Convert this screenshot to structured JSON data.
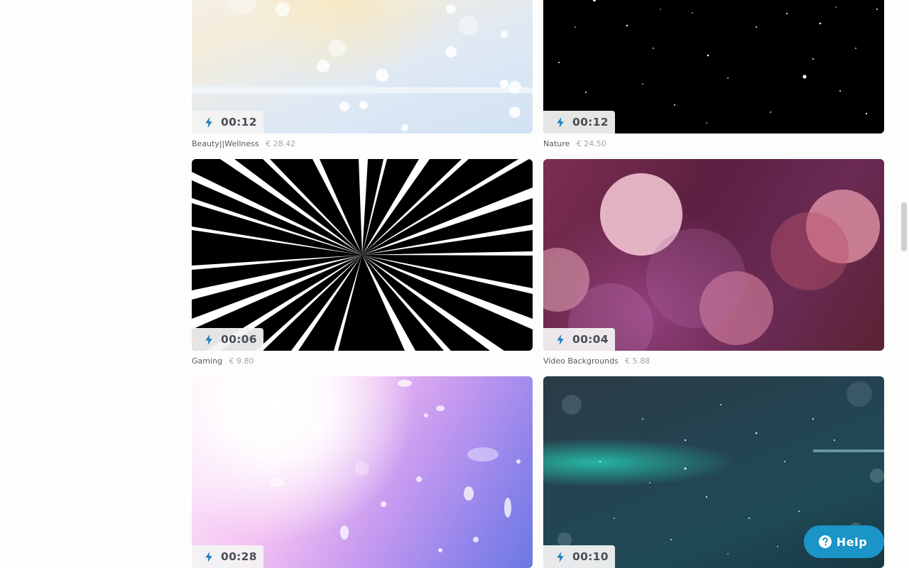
{
  "items": [
    {
      "duration": "00:12",
      "category": "Beauty||Wellness",
      "price": "€ 28.42",
      "thumbnail": "bokeh-light"
    },
    {
      "duration": "00:12",
      "category": "Nature",
      "price": "€ 24.50",
      "thumbnail": "starfield"
    },
    {
      "duration": "00:06",
      "category": "Gaming",
      "price": "€ 9.80",
      "thumbnail": "speed-lines"
    },
    {
      "duration": "00:04",
      "category": "Video Backgrounds",
      "price": "€ 5.88",
      "thumbnail": "pink-bokeh"
    },
    {
      "duration": "00:28",
      "category": "",
      "price": "",
      "thumbnail": "pastel-particles"
    },
    {
      "duration": "00:10",
      "category": "",
      "price": "",
      "thumbnail": "teal-particles"
    }
  ],
  "help": {
    "label": "Help"
  },
  "icons": {
    "duration": "lightning-icon",
    "help": "question-circle-icon"
  },
  "colors": {
    "help_button": "#1b95c8",
    "badge_bg": "#f3f3f3",
    "badge_text": "#4a4f55"
  }
}
